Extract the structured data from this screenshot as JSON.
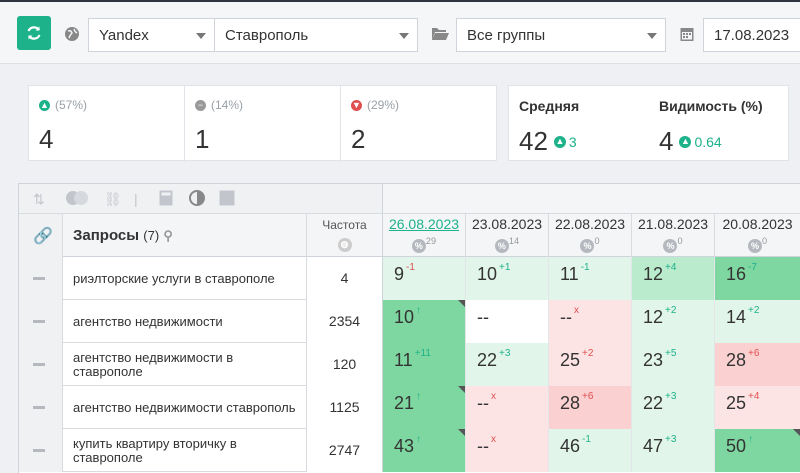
{
  "toolbar": {
    "search_engine": "Yandex",
    "region": "Ставрополь",
    "group": "Все группы",
    "date": "17.08.2023"
  },
  "stats": {
    "up": {
      "pct": "(57%)",
      "count": "4"
    },
    "same": {
      "pct": "(14%)",
      "count": "1"
    },
    "down": {
      "pct": "(29%)",
      "count": "2"
    },
    "average": {
      "label": "Средняя",
      "value": "42",
      "delta": "3"
    },
    "visibility": {
      "label": "Видимость (%)",
      "value": "4",
      "delta": "0.64"
    }
  },
  "table": {
    "queries_label": "Запросы",
    "queries_count": "(7)",
    "freq_label": "Частота",
    "dates": [
      {
        "date": "26.08.2023",
        "sub": "29"
      },
      {
        "date": "23.08.2023",
        "sub": "14"
      },
      {
        "date": "22.08.2023",
        "sub": "0"
      },
      {
        "date": "21.08.2023",
        "sub": "0"
      },
      {
        "date": "20.08.2023",
        "sub": "0"
      }
    ],
    "rows": [
      {
        "query": "риэлторские услуги в ставрополе",
        "freq": "4",
        "pos": [
          {
            "v": "9",
            "d": "-1"
          },
          {
            "v": "10",
            "d": "+1"
          },
          {
            "v": "11",
            "d": "-1"
          },
          {
            "v": "12",
            "d": "+4"
          },
          {
            "v": "16",
            "d": "-7"
          }
        ]
      },
      {
        "query": "агентство недвижимости",
        "freq": "2354",
        "pos": [
          {
            "v": "10",
            "d": "↑"
          },
          {
            "v": "--",
            "d": ""
          },
          {
            "v": "--",
            "d": "x"
          },
          {
            "v": "12",
            "d": "+2"
          },
          {
            "v": "14",
            "d": "+2"
          }
        ]
      },
      {
        "query": "агентство недвижимости в ставрополе",
        "freq": "120",
        "pos": [
          {
            "v": "11",
            "d": "+11"
          },
          {
            "v": "22",
            "d": "+3"
          },
          {
            "v": "25",
            "d": "+2"
          },
          {
            "v": "23",
            "d": "+5"
          },
          {
            "v": "28",
            "d": "+6"
          }
        ]
      },
      {
        "query": "агентство недвижимости ставрополь",
        "freq": "1125",
        "pos": [
          {
            "v": "21",
            "d": "↑"
          },
          {
            "v": "--",
            "d": "x"
          },
          {
            "v": "28",
            "d": "+6"
          },
          {
            "v": "22",
            "d": "+3"
          },
          {
            "v": "25",
            "d": "+4"
          }
        ]
      },
      {
        "query": "купить квартиру вторичку в ставрополе",
        "freq": "2747",
        "pos": [
          {
            "v": "43",
            "d": "↑"
          },
          {
            "v": "--",
            "d": "x"
          },
          {
            "v": "46",
            "d": "-1"
          },
          {
            "v": "47",
            "d": "+3"
          },
          {
            "v": "50",
            "d": "↑"
          }
        ]
      }
    ]
  }
}
